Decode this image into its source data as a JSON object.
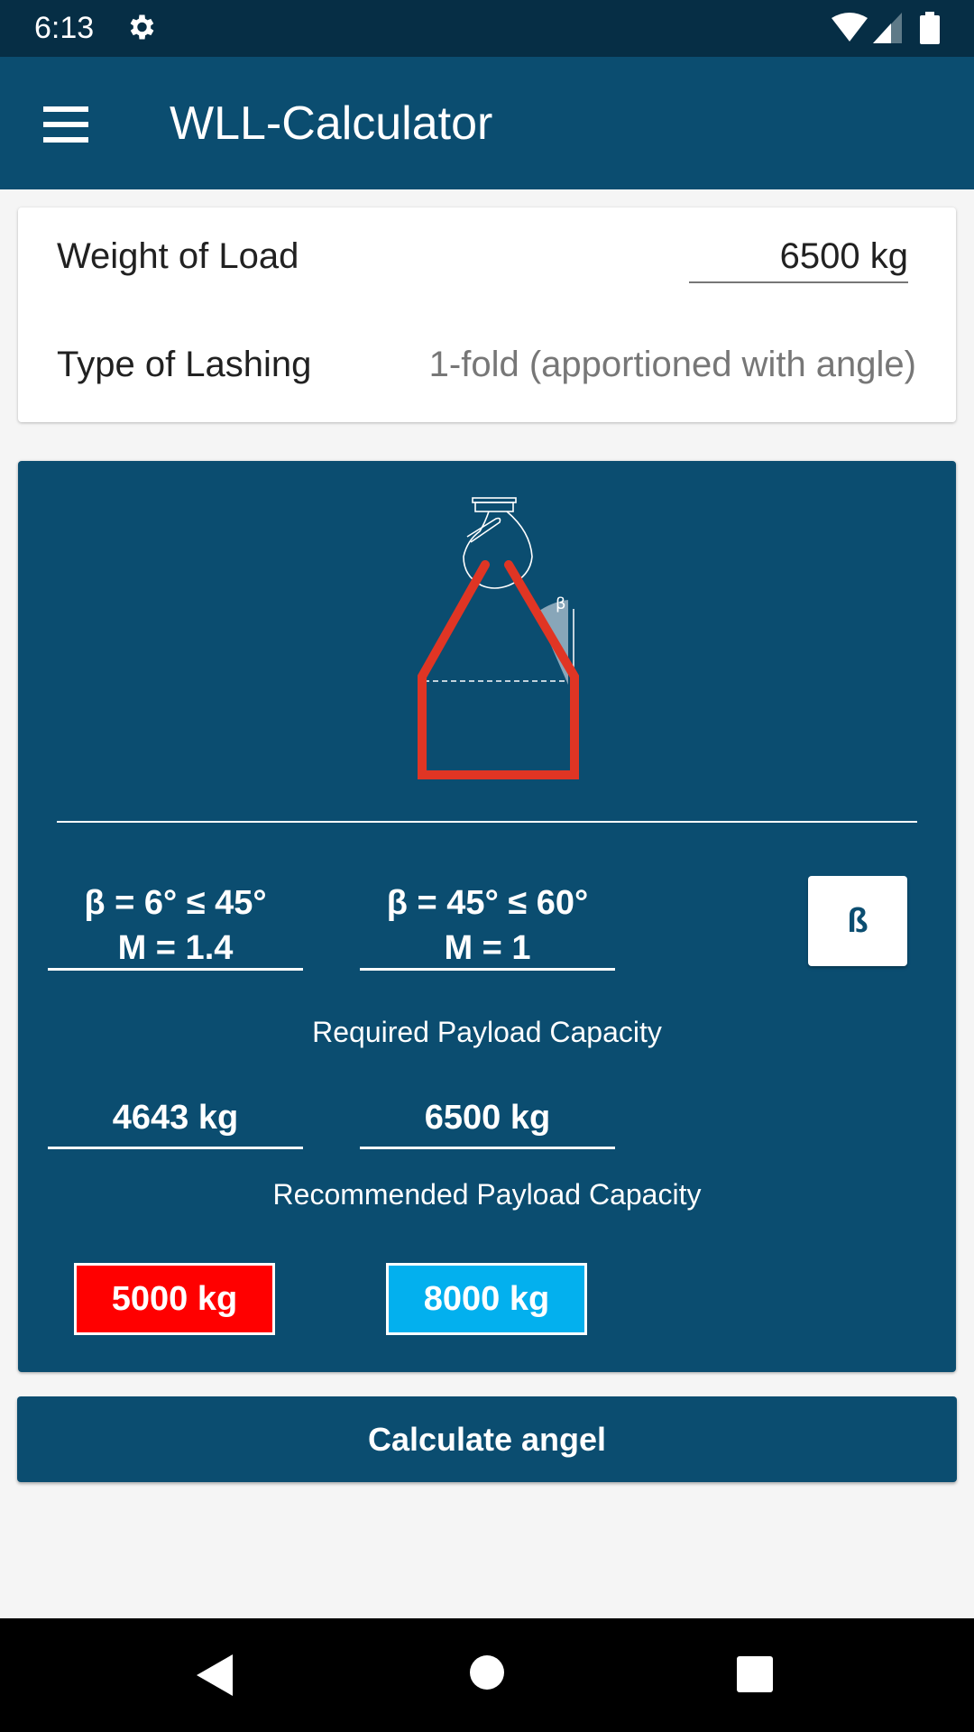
{
  "status_bar": {
    "time": "6:13",
    "icons": [
      "gear-icon",
      "wifi-icon",
      "signal-icon",
      "battery-icon"
    ]
  },
  "app_bar": {
    "title": "WLL-Calculator",
    "menu_icon": "hamburger-menu-icon"
  },
  "inputs": {
    "weight_label": "Weight of Load",
    "weight_value": "6500 kg",
    "lashing_label": "Type of Lashing",
    "lashing_value": "1-fold (apportioned with angle)"
  },
  "diagram": {
    "angle_symbol": "β"
  },
  "ranges": [
    {
      "angle": "β = 6° ≤ 45°",
      "factor": "M = 1.4"
    },
    {
      "angle": "β = 45° ≤ 60°",
      "factor": "M = 1"
    }
  ],
  "beta_button": "ß",
  "required": {
    "label": "Required Payload Capacity",
    "values": [
      "4643 kg",
      "6500 kg"
    ]
  },
  "recommended": {
    "label": "Recommended Payload Capacity",
    "values": [
      {
        "text": "5000 kg",
        "color": "#ff0000"
      },
      {
        "text": "8000 kg",
        "color": "#03b0ee"
      }
    ]
  },
  "calculate_button": "Calculate angel",
  "nav": [
    "back-icon",
    "home-icon",
    "recents-icon"
  ]
}
